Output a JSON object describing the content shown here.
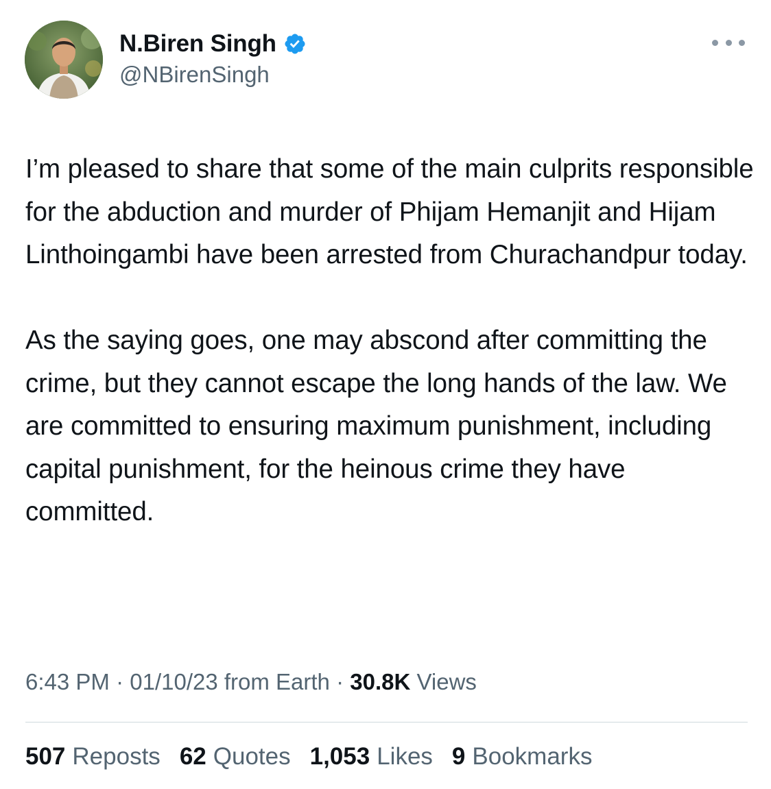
{
  "author": {
    "display_name": "N.Biren Singh",
    "handle": "@NBirenSingh",
    "verified": true
  },
  "tweet": {
    "paragraphs": [
      "I’m pleased to share that some of the main culprits responsible for the abduction and murder of Phijam Hemanjit and Hijam Linthoingambi have been arrested from Churachandpur today.",
      "As the saying goes, one may abscond after committing the crime, but they cannot escape the long hands of the law. We are committed to ensuring maximum punishment, including capital punishment, for the heinous crime they have committed."
    ]
  },
  "meta": {
    "time": "6:43 PM",
    "sep1": " · ",
    "date": "01/10/23",
    "source": " from Earth",
    "sep2": " · ",
    "views_count": "30.8K",
    "views_label": " Views"
  },
  "stats": {
    "reposts": {
      "count": "507",
      "label": "Reposts"
    },
    "quotes": {
      "count": "62",
      "label": "Quotes"
    },
    "likes": {
      "count": "1,053",
      "label": "Likes"
    },
    "bookmarks": {
      "count": "9",
      "label": "Bookmarks"
    }
  },
  "colors": {
    "text_primary": "#0f1419",
    "text_secondary": "#536471",
    "verified_blue": "#1d9bf0",
    "divider": "#cfd9de"
  },
  "icons": {
    "verified": "verified-badge-icon",
    "more": "more-options-icon"
  }
}
